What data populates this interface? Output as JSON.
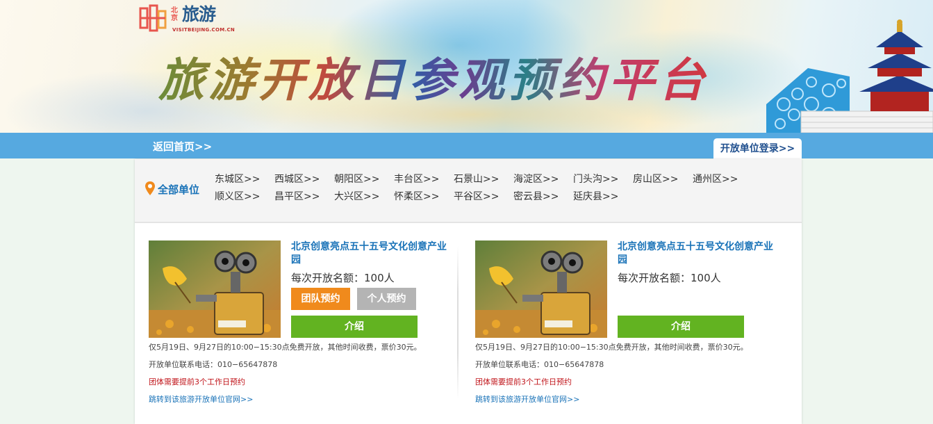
{
  "site": {
    "logo_small": "北京",
    "logo_big": "旅游",
    "logo_url": "VISITBEIJING.COM.CN",
    "banner_title": "旅游开放日参观预约平台"
  },
  "nav": {
    "home_link": "返回首页>>",
    "login_tab": "开放单位登录>>"
  },
  "filter": {
    "all_units": "全部单位",
    "districts_row1": [
      "东城区>>",
      "西城区>>",
      "朝阳区>>",
      "丰台区>>",
      "石景山>>",
      "海淀区>>",
      "门头沟>>",
      "房山区>>",
      "通州区>>"
    ],
    "districts_row2": [
      "顺义区>>",
      "昌平区>>",
      "大兴区>>",
      "怀柔区>>",
      "平谷区>>",
      "密云县>>",
      "延庆县>>"
    ]
  },
  "cards": [
    {
      "title": "北京创意亮点五十五号文化创意产业园",
      "quota_label": "每次开放名额：",
      "quota_value": "100人",
      "btn_team": "团队预约",
      "btn_personal": "个人预约",
      "btn_intro": "介绍",
      "note_hours": "仅5月19日、9月27日的10:00−15:30点免费开放，其他时间收费，票价30元。",
      "note_phone": "开放单位联系电话：010−65647878",
      "note_group": "团体需要提前3个工作日预约",
      "note_link": "跳转到该旅游开放单位官网>>"
    },
    {
      "title": "北京创意亮点五十五号文化创意产业园",
      "quota_label": "每次开放名额：",
      "quota_value": "100人",
      "btn_intro": "介绍",
      "note_hours": "仅5月19日、9月27日的10:00−15:30点免费开放，其他时间收费，票价30元。",
      "note_phone": "开放单位联系电话：010−65647878",
      "note_group": "团体需要提前3个工作日预约",
      "note_link": "跳转到该旅游开放单位官网>>"
    }
  ],
  "colors": {
    "nav_blue": "#56a9e0",
    "link_blue": "#1a73b8",
    "team_orange": "#f08a1c",
    "personal_gray": "#b4b4b4",
    "intro_green": "#62b321",
    "notice_red": "#c0141a"
  }
}
